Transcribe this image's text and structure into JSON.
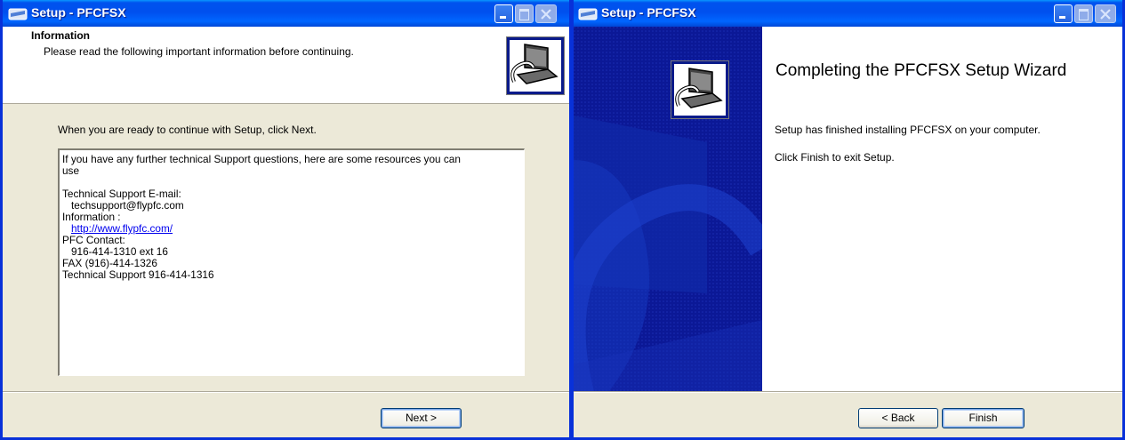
{
  "windows": [
    {
      "title": "Setup - PFCFSX",
      "page_title": "Information",
      "page_subtitle": "Please read the following important information before continuing.",
      "intro": "When you are ready to continue with Setup, click Next.",
      "info_lines": [
        "If you have any further technical Support questions, here are some resources you can",
        "use",
        "",
        "Technical Support E-mail:",
        "techsupport@flypfc.com",
        "Information :",
        "http://www.flypfc.com/",
        "PFC Contact:",
        "916-414-1310 ext 16",
        "FAX (916)-414-1326",
        "Technical Support 916-414-1316"
      ],
      "next_label": "Next >"
    },
    {
      "title": "Setup - PFCFSX",
      "heading": "Completing the PFCFSX Setup Wizard",
      "text1": "Setup has finished installing PFCFSX on your computer.",
      "text2": "Click Finish to exit Setup.",
      "back_label": "< Back",
      "finish_label": "Finish"
    }
  ],
  "colors": {
    "titlebar": "#0053ee",
    "window_border": "#0831d9",
    "dialog_bg": "#ece9d8",
    "side_panel": "#0a1a9e",
    "link": "#0000ee"
  },
  "icons": [
    "app-icon",
    "minimize-icon",
    "maximize-icon",
    "close-icon",
    "setup-computer-icon"
  ]
}
